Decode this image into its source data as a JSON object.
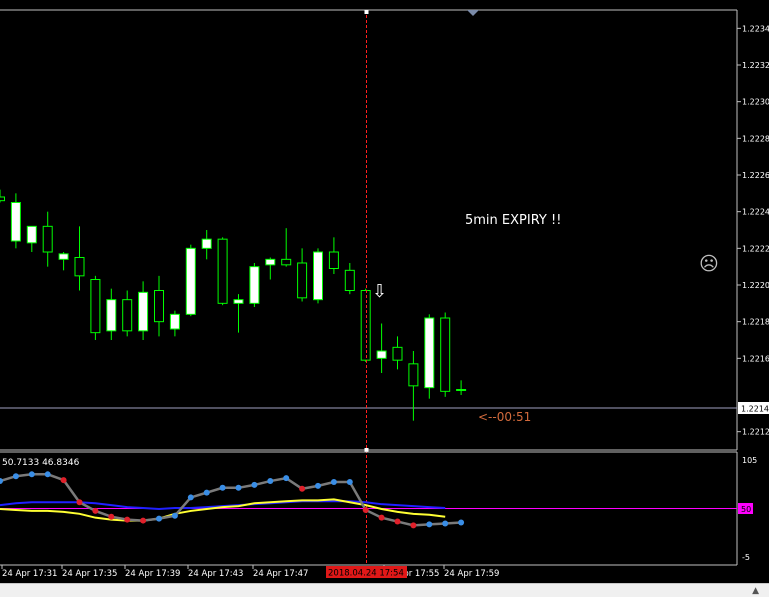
{
  "chart": {
    "annotation_text": "5min EXPIRY !!",
    "countdown_text": "<--00:51",
    "smiley": "☹",
    "arrow_glyph": "⇩",
    "current_price_label": "1.2214",
    "price_ticks": [
      "1.2234",
      "1.2232",
      "1.2230",
      "1.2228",
      "1.2226",
      "1.2224",
      "1.2222",
      "1.2220",
      "1.2218",
      "1.2216",
      "1.2214",
      "1.2212"
    ],
    "time_ticks": [
      "24 Apr 17:31",
      "24 Apr 17:35",
      "24 Apr 17:39",
      "24 Apr 17:43",
      "24 Apr 17:47",
      "24 Apr 17:55",
      "24 Apr 17:59"
    ],
    "crosshair_time_label": "2018.04.24 17:54",
    "colors": {
      "background": "#000000",
      "candle_up": "#ffffff",
      "candle_wick": "#00ff00",
      "crosshair": "#ff2020",
      "price_line": "#a0a0c0",
      "countdown": "#d26a3c"
    }
  },
  "indicator": {
    "header_values": "50.7133 46.8346",
    "scale_top": "105",
    "level_label": "50",
    "scale_bottom": "-5",
    "colors": {
      "line_main": "#7a7a7a",
      "dot_up": "#3a8ee6",
      "dot_down": "#e0202a",
      "signal_yellow": "#ffff33",
      "signal_blue": "#2020ff",
      "level_line": "#ff00ff"
    }
  },
  "chart_data": {
    "type": "candlestick",
    "ylim": [
      1.2211,
      1.2235
    ],
    "candles": [
      {
        "o": 1.22248,
        "h": 1.22252,
        "l": 1.22245,
        "c": 1.22246
      },
      {
        "o": 1.22224,
        "h": 1.2225,
        "l": 1.2222,
        "c": 1.22245
      },
      {
        "o": 1.22223,
        "h": 1.22232,
        "l": 1.22218,
        "c": 1.22232
      },
      {
        "o": 1.22232,
        "h": 1.2224,
        "l": 1.2221,
        "c": 1.22218
      },
      {
        "o": 1.22214,
        "h": 1.22218,
        "l": 1.22208,
        "c": 1.22217
      },
      {
        "o": 1.22215,
        "h": 1.22232,
        "l": 1.22197,
        "c": 1.22205
      },
      {
        "o": 1.22203,
        "h": 1.22205,
        "l": 1.2217,
        "c": 1.22174
      },
      {
        "o": 1.22175,
        "h": 1.22198,
        "l": 1.2217,
        "c": 1.22192
      },
      {
        "o": 1.22192,
        "h": 1.22197,
        "l": 1.22172,
        "c": 1.22175
      },
      {
        "o": 1.22175,
        "h": 1.22202,
        "l": 1.2217,
        "c": 1.22196
      },
      {
        "o": 1.22197,
        "h": 1.22205,
        "l": 1.22172,
        "c": 1.2218
      },
      {
        "o": 1.22176,
        "h": 1.22186,
        "l": 1.22172,
        "c": 1.22184
      },
      {
        "o": 1.22184,
        "h": 1.22222,
        "l": 1.22183,
        "c": 1.2222
      },
      {
        "o": 1.2222,
        "h": 1.2223,
        "l": 1.22214,
        "c": 1.22225
      },
      {
        "o": 1.22225,
        "h": 1.22226,
        "l": 1.22189,
        "c": 1.2219
      },
      {
        "o": 1.2219,
        "h": 1.22195,
        "l": 1.22174,
        "c": 1.22192
      },
      {
        "o": 1.2219,
        "h": 1.22212,
        "l": 1.22188,
        "c": 1.2221
      },
      {
        "o": 1.22211,
        "h": 1.22215,
        "l": 1.22203,
        "c": 1.22214
      },
      {
        "o": 1.22214,
        "h": 1.22231,
        "l": 1.2221,
        "c": 1.22211
      },
      {
        "o": 1.22212,
        "h": 1.2222,
        "l": 1.22191,
        "c": 1.22193
      },
      {
        "o": 1.22192,
        "h": 1.2222,
        "l": 1.2219,
        "c": 1.22218
      },
      {
        "o": 1.22218,
        "h": 1.22226,
        "l": 1.22206,
        "c": 1.22209
      },
      {
        "o": 1.22208,
        "h": 1.22212,
        "l": 1.22195,
        "c": 1.22197
      },
      {
        "o": 1.22197,
        "h": 1.22198,
        "l": 1.22158,
        "c": 1.22159
      },
      {
        "o": 1.2216,
        "h": 1.22179,
        "l": 1.22152,
        "c": 1.22164
      },
      {
        "o": 1.22166,
        "h": 1.22172,
        "l": 1.22154,
        "c": 1.22159
      },
      {
        "o": 1.22157,
        "h": 1.22164,
        "l": 1.22126,
        "c": 1.22145
      },
      {
        "o": 1.22144,
        "h": 1.22184,
        "l": 1.22138,
        "c": 1.22182
      },
      {
        "o": 1.22182,
        "h": 1.22185,
        "l": 1.22139,
        "c": 1.22142
      },
      {
        "o": 1.22143,
        "h": 1.22148,
        "l": 1.2214,
        "c": 1.22143
      }
    ],
    "current_price": 1.22142,
    "oscillator": {
      "ylim": [
        -5,
        105
      ],
      "main": [
        79,
        84,
        86,
        86,
        80,
        57,
        48,
        42,
        39,
        38,
        40,
        43,
        62,
        67,
        72,
        72,
        75,
        79,
        82,
        71,
        74,
        78,
        78,
        49,
        41,
        37,
        33,
        34,
        35,
        36
      ],
      "signal_yellow": [
        50,
        49,
        48,
        48,
        47,
        45,
        41,
        39,
        38,
        38,
        40,
        45,
        48,
        50,
        52,
        53,
        56,
        57,
        58,
        59,
        59,
        60,
        57,
        54,
        50,
        47,
        45,
        44,
        42
      ],
      "signal_blue": [
        54,
        56,
        57,
        57,
        57,
        57,
        56,
        54,
        52,
        51,
        50,
        51,
        51,
        52,
        53,
        54,
        55,
        56,
        57,
        58,
        58,
        58,
        58,
        57,
        55,
        54,
        53,
        52,
        51
      ],
      "level": 50
    }
  }
}
